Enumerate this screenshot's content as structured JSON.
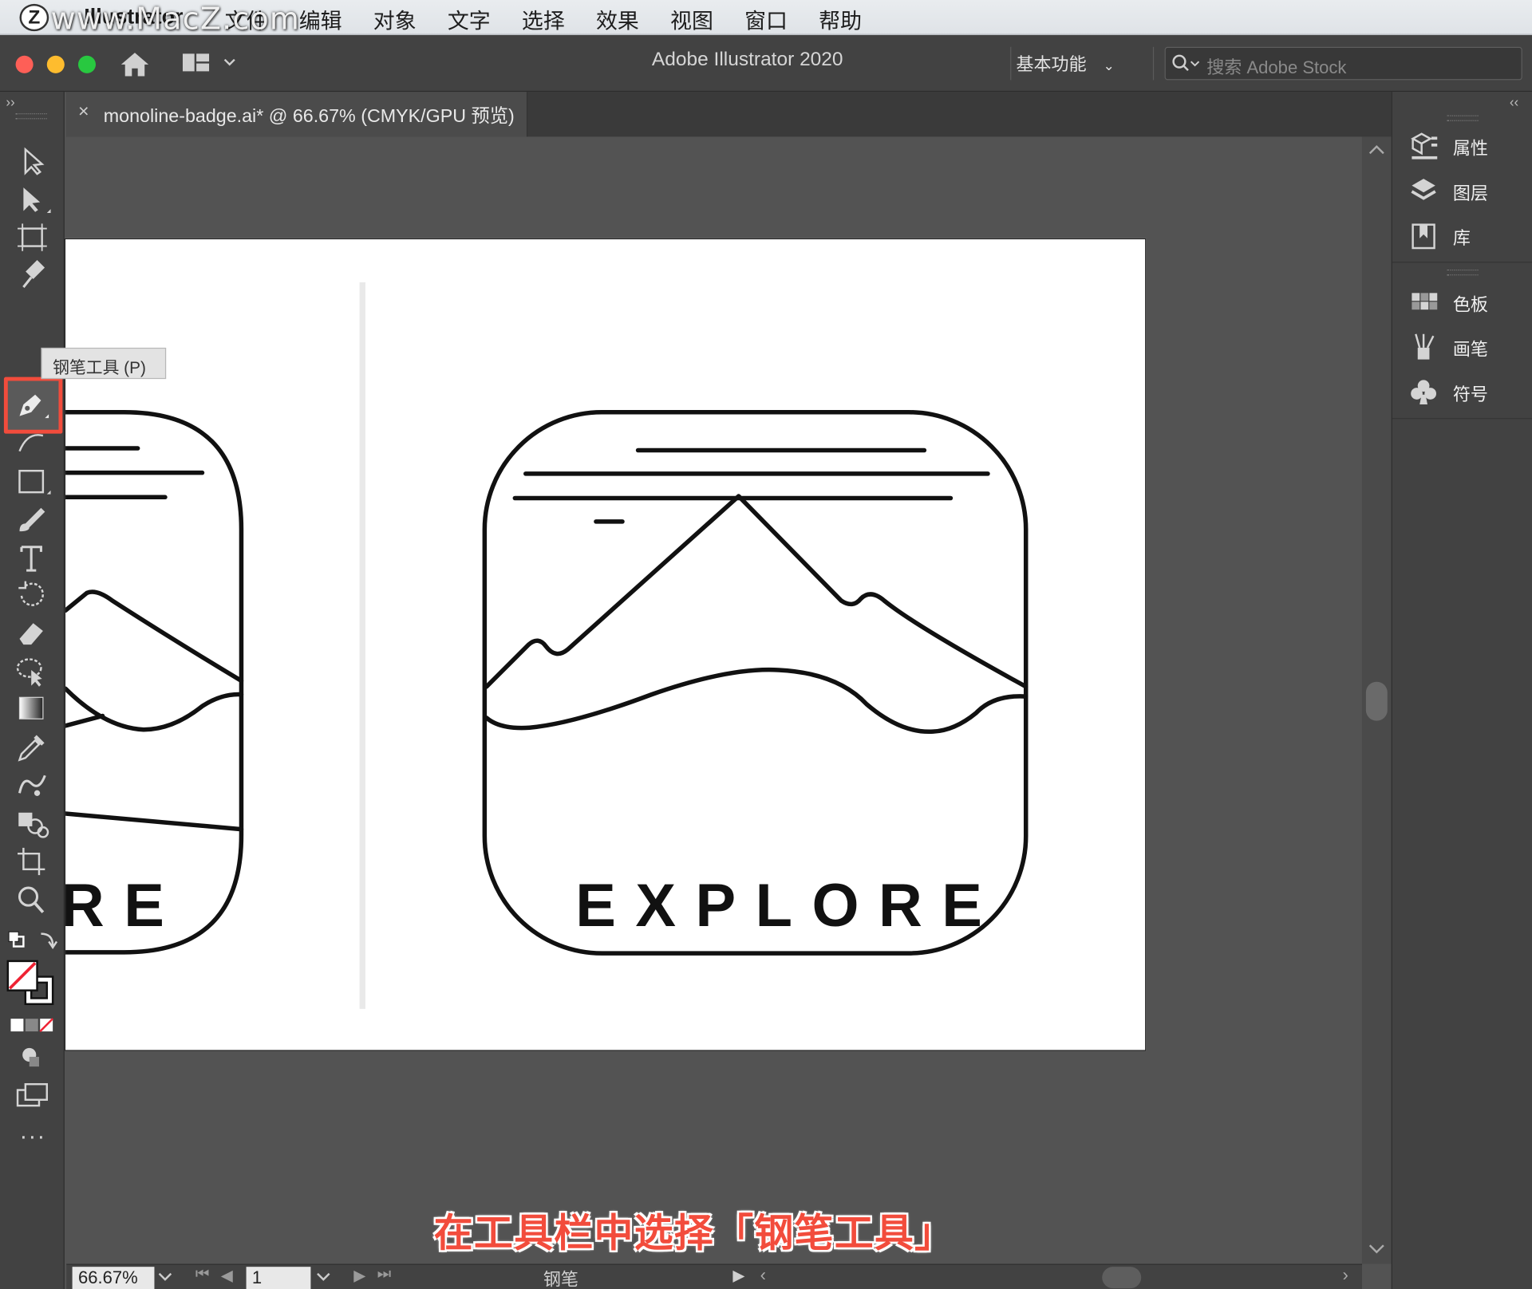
{
  "menubar": {
    "app_name": "Illustrator",
    "items": [
      "文件",
      "编辑",
      "对象",
      "文字",
      "选择",
      "效果",
      "视图",
      "窗口",
      "帮助"
    ],
    "watermark": "www.MacZ.com"
  },
  "appbar": {
    "title": "Adobe Illustrator 2020",
    "workspace": "基本功能",
    "search_placeholder": "搜索 Adobe Stock"
  },
  "document_tab": {
    "close": "×",
    "label": "monoline-badge.ai* @ 66.67% (CMYK/GPU 预览)"
  },
  "tooltip": "钢笔工具 (P)",
  "artboard": {
    "badge_text": "EXPLORE",
    "partial_text": "RE"
  },
  "panels": {
    "group1": [
      {
        "label": "属性",
        "icon": "properties-icon"
      },
      {
        "label": "图层",
        "icon": "layers-icon"
      },
      {
        "label": "库",
        "icon": "libraries-icon"
      }
    ],
    "group2": [
      {
        "label": "色板",
        "icon": "swatches-icon"
      },
      {
        "label": "画笔",
        "icon": "brushes-icon"
      },
      {
        "label": "符号",
        "icon": "symbols-icon"
      }
    ]
  },
  "statusbar": {
    "zoom": "66.67%",
    "page": "1",
    "current_tool": "钢笔"
  },
  "caption": "在工具栏中选择「钢笔工具」",
  "colors": {
    "highlight": "#f24c3c",
    "ui_dark": "#424242",
    "canvas": "#535353",
    "close_light": "#fe5f57",
    "min_light": "#febc2e",
    "max_light": "#28c840"
  }
}
